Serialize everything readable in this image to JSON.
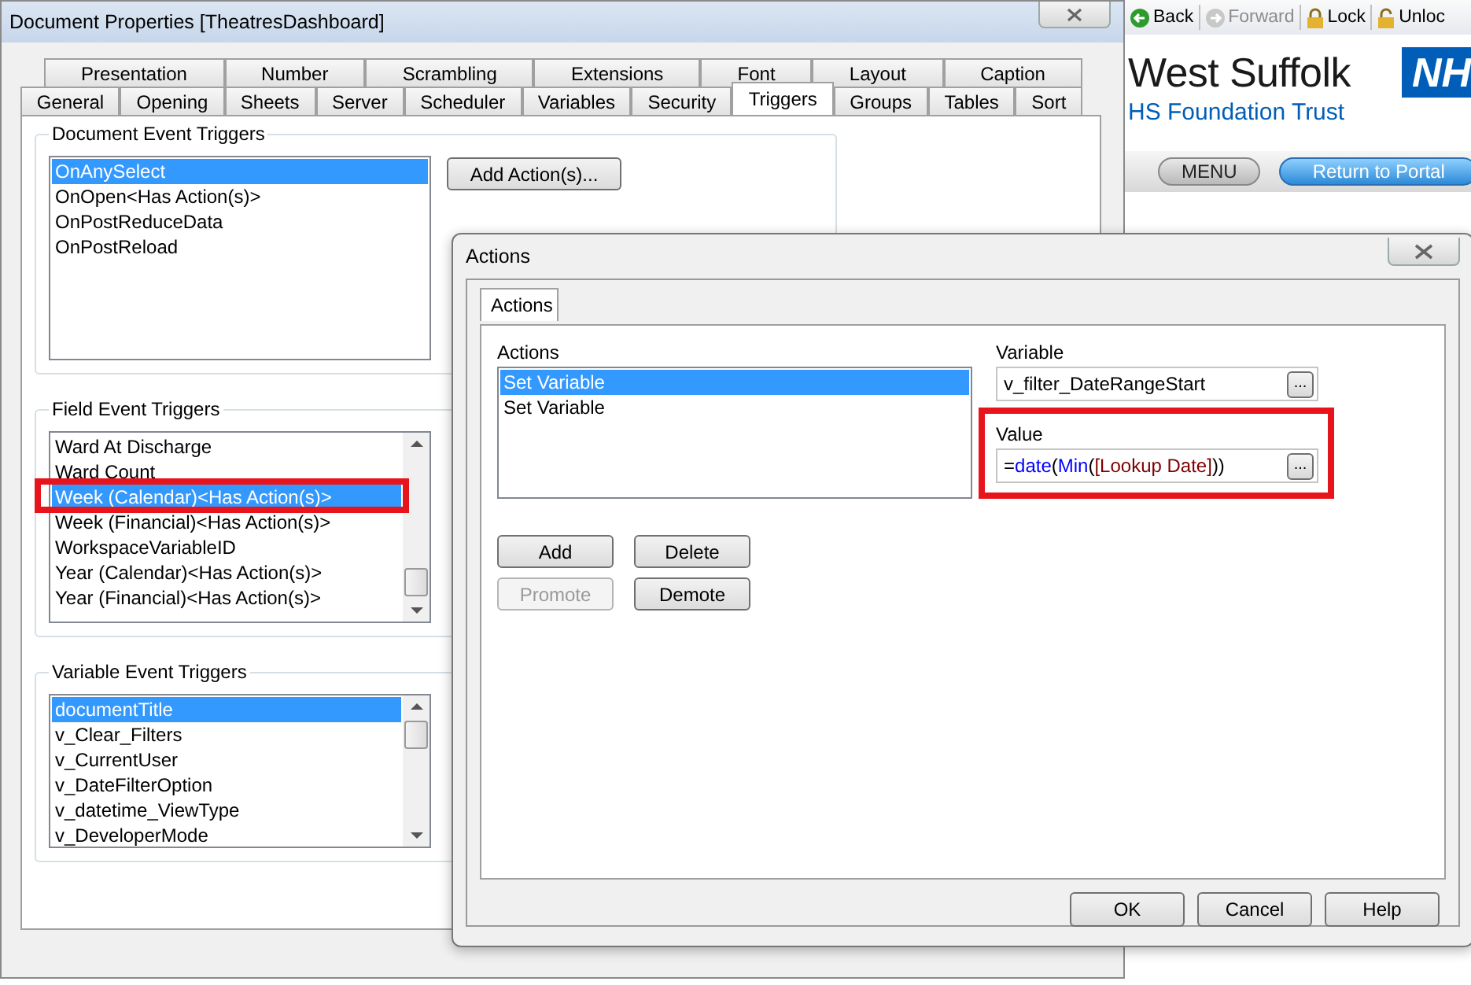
{
  "browser": {
    "nav": [
      {
        "label": "Back",
        "disabled": false
      },
      {
        "label": "Forward",
        "disabled": true
      },
      {
        "label": "Lock",
        "disabled": false
      },
      {
        "label": "Unloc",
        "disabled": false
      }
    ],
    "logo_name": "West Suffolk",
    "logo_badge": "NH",
    "logo_subtitle": "HS Foundation Trust",
    "menu": [
      {
        "label": "MENU",
        "kind": "plain"
      },
      {
        "label": "Return to Portal",
        "kind": "primary"
      }
    ]
  },
  "properties": {
    "title": "Document Properties [TheatresDashboard]",
    "tab_rows": [
      [
        {
          "label": "Presentation",
          "selected": false
        },
        {
          "label": "Number",
          "selected": false
        },
        {
          "label": "Scrambling",
          "selected": false
        },
        {
          "label": "Extensions",
          "selected": false
        },
        {
          "label": "Font",
          "selected": false
        },
        {
          "label": "Layout",
          "selected": false
        },
        {
          "label": "Caption",
          "selected": false
        }
      ],
      [
        {
          "label": "General",
          "selected": false
        },
        {
          "label": "Opening",
          "selected": false
        },
        {
          "label": "Sheets",
          "selected": false
        },
        {
          "label": "Server",
          "selected": false
        },
        {
          "label": "Scheduler",
          "selected": false
        },
        {
          "label": "Variables",
          "selected": false
        },
        {
          "label": "Security",
          "selected": false
        },
        {
          "label": "Triggers",
          "selected": true
        },
        {
          "label": "Groups",
          "selected": false
        },
        {
          "label": "Tables",
          "selected": false
        },
        {
          "label": "Sort",
          "selected": false
        }
      ]
    ],
    "groups": [
      {
        "title": "Document Event Triggers",
        "button": "Add Action(s)...",
        "items": [
          {
            "label": "OnAnySelect",
            "selected": true
          },
          {
            "label": "OnOpen<Has Action(s)>",
            "selected": false
          },
          {
            "label": "OnPostReduceData",
            "selected": false
          },
          {
            "label": "OnPostReload",
            "selected": false
          }
        ]
      },
      {
        "title": "Field Event Triggers",
        "items": [
          {
            "label": "Ward At Discharge",
            "selected": false
          },
          {
            "label": "Ward Count",
            "selected": false
          },
          {
            "label": "Week (Calendar)<Has Action(s)>",
            "selected": true
          },
          {
            "label": "Week (Financial)<Has Action(s)>",
            "selected": false
          },
          {
            "label": "WorkspaceVariableID",
            "selected": false
          },
          {
            "label": "Year (Calendar)<Has Action(s)>",
            "selected": false
          },
          {
            "label": "Year (Financial)<Has Action(s)>",
            "selected": false
          }
        ]
      },
      {
        "title": "Variable Event Triggers",
        "items": [
          {
            "label": "documentTitle",
            "selected": true
          },
          {
            "label": "v_Clear_Filters",
            "selected": false
          },
          {
            "label": "v_CurrentUser",
            "selected": false
          },
          {
            "label": "v_DateFilterOption",
            "selected": false
          },
          {
            "label": "v_datetime_ViewType",
            "selected": false
          },
          {
            "label": "v_DeveloperMode",
            "selected": false
          }
        ]
      }
    ]
  },
  "actions_dialog": {
    "title": "Actions",
    "tab": "Actions",
    "actions_label": "Actions",
    "actions": [
      {
        "label": "Set Variable",
        "selected": true
      },
      {
        "label": "Set Variable",
        "selected": false
      }
    ],
    "buttons": [
      {
        "label": "Add",
        "disabled": false
      },
      {
        "label": "Delete",
        "disabled": false
      },
      {
        "label": "Promote",
        "disabled": true
      },
      {
        "label": "Demote",
        "disabled": false
      }
    ],
    "variable_label": "Variable",
    "variable": "v_filter_DateRangeStart",
    "variable_browse": "...",
    "value_label": "Value",
    "value": [
      {
        "text": "=",
        "kind": "plain"
      },
      {
        "text": "date",
        "kind": "function"
      },
      {
        "text": "(",
        "kind": "plain"
      },
      {
        "text": "Min",
        "kind": "function"
      },
      {
        "text": "(",
        "kind": "plain"
      },
      {
        "text": "[Lookup Date]",
        "kind": "field"
      },
      {
        "text": "))",
        "kind": "plain"
      }
    ],
    "value_browse": "...",
    "footer": [
      "OK",
      "Cancel",
      "Help"
    ]
  }
}
